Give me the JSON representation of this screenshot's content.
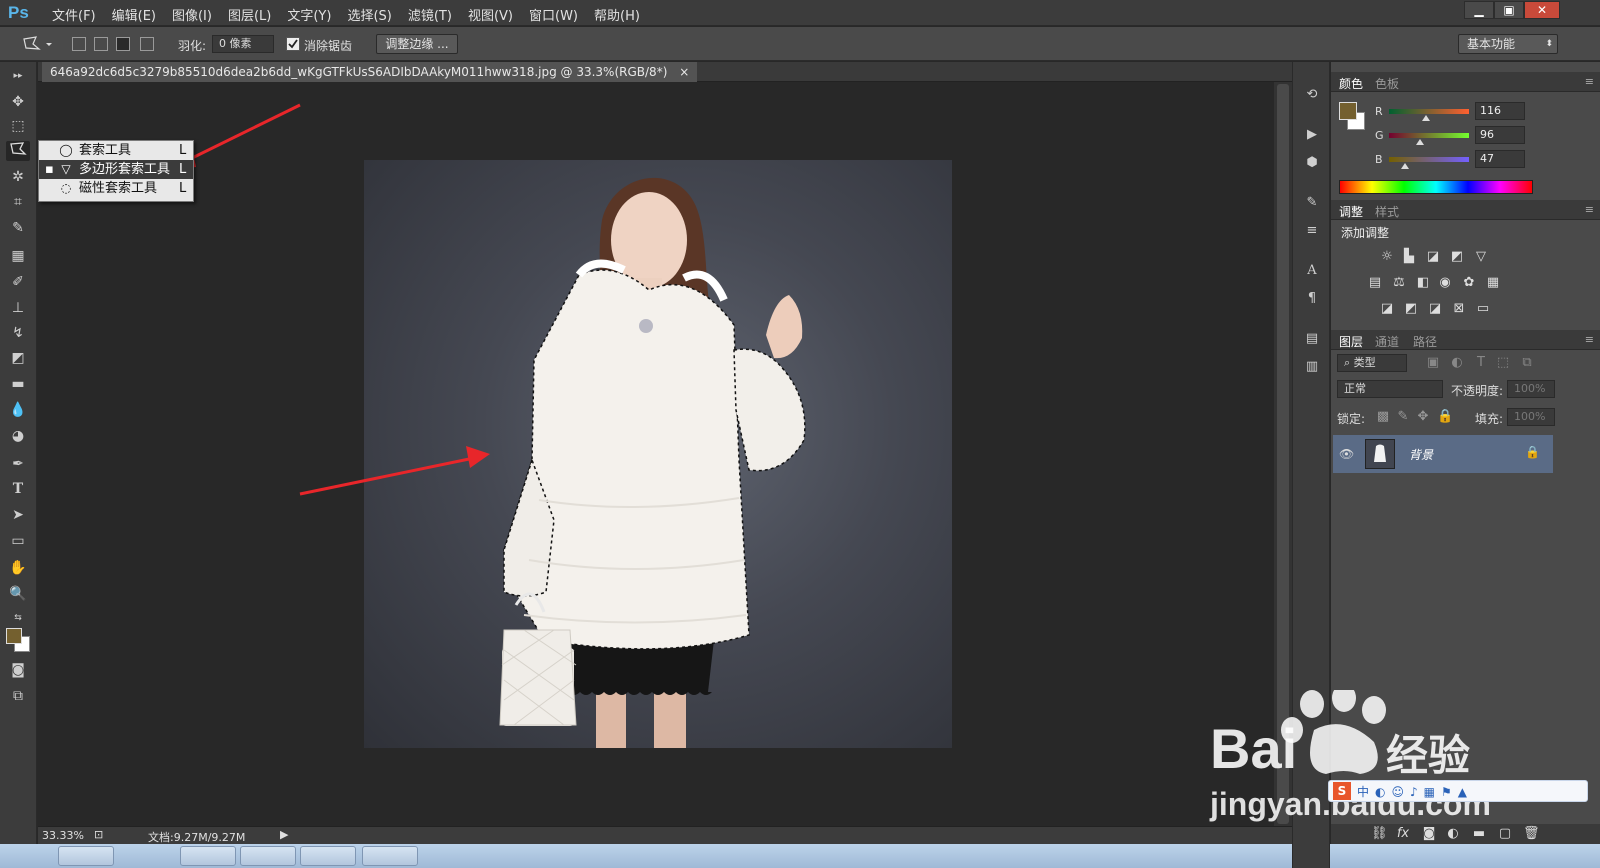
{
  "app": {
    "logo": "Ps"
  },
  "menu": [
    "文件(F)",
    "编辑(E)",
    "图像(I)",
    "图层(L)",
    "文字(Y)",
    "选择(S)",
    "滤镜(T)",
    "视图(V)",
    "窗口(W)",
    "帮助(H)"
  ],
  "window_controls": {
    "minimize": "▁",
    "restore": "▣",
    "close": "✕"
  },
  "options": {
    "feather_label": "羽化:",
    "feather_value": "0 像素",
    "antialias_label": "消除锯齿",
    "antialias_checked": true,
    "refine_edge_button": "调整边缘 ...",
    "workspace": "基本功能"
  },
  "document": {
    "tab_title": "646a92dc6d5c3279b85510d6dea2b6dd_wKgGTFkUsS6ADIbDAAkyM011hww318.jpg @ 33.3%(RGB/8*)",
    "close": "×"
  },
  "lasso_flyout": [
    {
      "label": "套索工具",
      "key": "L",
      "icon": "lasso-icon",
      "selected": false
    },
    {
      "label": "多边形套索工具",
      "key": "L",
      "icon": "polygonal-lasso-icon",
      "selected": true
    },
    {
      "label": "磁性套索工具",
      "key": "L",
      "icon": "magnetic-lasso-icon",
      "selected": false
    }
  ],
  "status": {
    "zoom": "33.33%",
    "doc_size": "文档:9.27M/9.27M"
  },
  "color_panel": {
    "tabs": [
      "颜色",
      "色板"
    ],
    "active_tab": "颜色",
    "foreground": "#74602f",
    "background": "#ffffff",
    "R": {
      "label": "R",
      "value": "116"
    },
    "G": {
      "label": "G",
      "value": "96"
    },
    "B": {
      "label": "B",
      "value": "47"
    }
  },
  "adjust_panel": {
    "tabs": [
      "调整",
      "样式"
    ],
    "active_tab": "调整",
    "title": "添加调整"
  },
  "layers_panel": {
    "tabs": [
      "图层",
      "通道",
      "路径"
    ],
    "active_tab": "图层",
    "filter_kind": "类型",
    "blend_mode": "正常",
    "opacity_label": "不透明度:",
    "opacity_value": "100%",
    "lock_label": "锁定:",
    "fill_label": "填充:",
    "fill_value": "100%",
    "layers": [
      {
        "name": "背景",
        "visible": true,
        "locked": true
      }
    ]
  },
  "watermark": {
    "brand": "Bai",
    "brand2": "经验",
    "site": "jingyan.baidu.com"
  },
  "colors": {
    "accent_ps": "#5ab6ea",
    "arrow": "#e8262a",
    "layer_highlight": "#5a6b86"
  }
}
